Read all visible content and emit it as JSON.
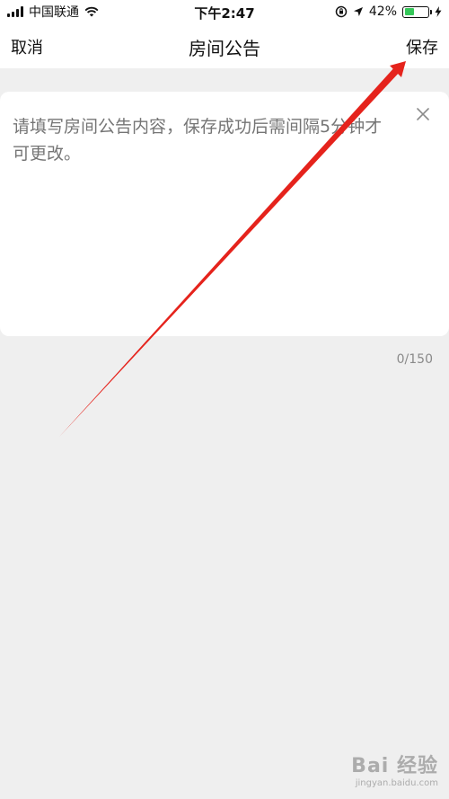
{
  "status_bar": {
    "carrier": "中国联通",
    "time": "下午2:47",
    "battery_percent": "42%",
    "battery_level": 0.42
  },
  "nav": {
    "cancel": "取消",
    "title": "房间公告",
    "save": "保存"
  },
  "editor": {
    "placeholder": "请填写房间公告内容，保存成功后需间隔5分钟才可更改。",
    "value": "",
    "char_count": "0/150"
  },
  "annotation": {
    "color": "#e5231c"
  },
  "watermark": {
    "brand": "Bai 经验",
    "url": "jingyan.baidu.com"
  },
  "colors": {
    "page_background": "#efefef",
    "card_background": "#ffffff",
    "placeholder": "#b2b2b2",
    "battery_fill": "#35c759"
  }
}
